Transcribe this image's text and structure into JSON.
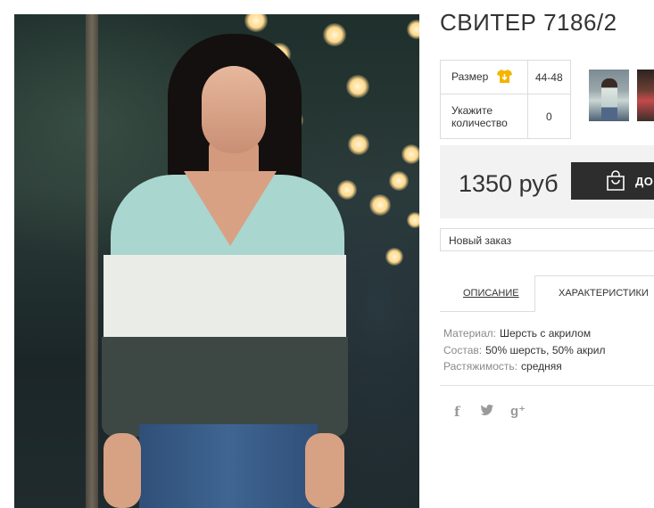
{
  "product": {
    "title": "СВИТЕР 7186/2"
  },
  "specs": {
    "size_label": "Размер",
    "size_value": "44-48",
    "quantity_label": "Укажите количество",
    "quantity_value": "0"
  },
  "purchase": {
    "price": "1350 руб",
    "cart_button_label": "ДОБ"
  },
  "order": {
    "selected": "Новый заказ"
  },
  "tabs": [
    {
      "label": "ОПИСАНИЕ",
      "active": false
    },
    {
      "label": "ХАРАКТЕРИСТИКИ",
      "active": true
    }
  ],
  "characteristics": [
    {
      "key": "Материал:",
      "value": "Шерсть с акрилом"
    },
    {
      "key": "Состав:",
      "value": "50% шерсть, 50% акрил"
    },
    {
      "key": "Растяжимость:",
      "value": "средняя"
    }
  ],
  "social": {
    "facebook": "f",
    "twitter": "🐦",
    "googleplus": "g⁺"
  },
  "icons": {
    "size": "shirt-icon",
    "cart": "shopping-bag-icon"
  },
  "colors": {
    "accent_yellow": "#f5b400",
    "button_dark": "#2d2d2d",
    "price_bg": "#f2f2f2"
  }
}
